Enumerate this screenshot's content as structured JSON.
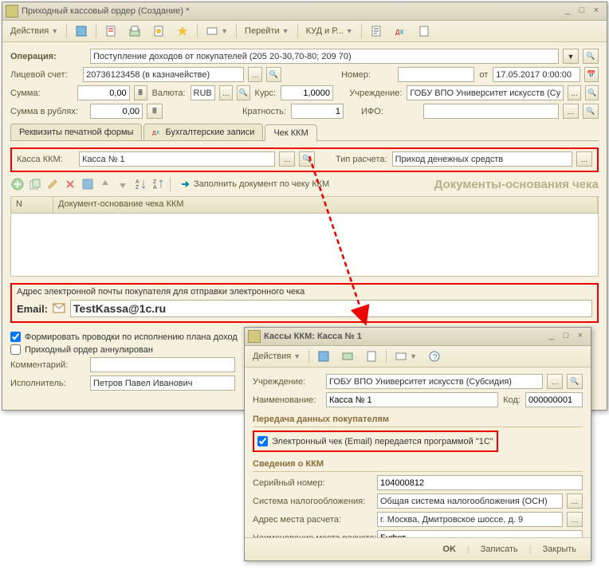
{
  "main": {
    "title": "Приходный кассовый ордер (Создание) *",
    "actions": "Действия",
    "goto": "Перейти",
    "kudir": "КУД и Р...",
    "op_lbl": "Операция:",
    "op_val": "Поступление доходов от покупателей (205 20-30,70-80; 209 70)",
    "acct_lbl": "Лицевой счет:",
    "acct_val": "20736123458 (в казначействе)",
    "num_lbl": "Номер:",
    "num_val": "",
    "ot": "от",
    "date": "17.05.2017 0:00:00",
    "sum_lbl": "Сумма:",
    "sum_val": "0,00",
    "cur_lbl": "Валюта:",
    "cur_val": "RUB",
    "rate_lbl": "Курс:",
    "rate_val": "1,0000",
    "inst_lbl": "Учреждение:",
    "inst_val": "ГОБУ ВПО Университет искусств (Су",
    "sumr_lbl": "Сумма в рублях:",
    "sumr_val": "0,00",
    "mult_lbl": "Кратность:",
    "mult_val": "1",
    "ifo_lbl": "ИФО:",
    "ifo_val": "",
    "tabs": [
      "Реквизиты печатной формы",
      "Бухгалтерские записи",
      "Чек ККМ"
    ],
    "kkm_lbl": "Касса ККМ:",
    "kkm_val": "Касса № 1",
    "calc_lbl": "Тип расчета:",
    "calc_val": "Приход денежных средств",
    "fill": "Заполнить документ по чеку ККМ",
    "dochdr": "Документы-основания чека",
    "col_n": "N",
    "col_doc": "Документ-основание чека ККМ",
    "email_hdr": "Адрес электронной почты покупателя для отправки электронного чека",
    "email_lbl": "Email:",
    "email_val": "TestKassa@1c.ru",
    "chk1": "Формировать проводки по исполнению плана доход",
    "chk2": "Приходный ордер аннулирован",
    "comment_lbl": "Комментарий:",
    "comment_val": "",
    "exec_lbl": "Исполнитель:",
    "exec_val": "Петров Павел Иванович"
  },
  "sub": {
    "title": "Кассы ККМ: Касса № 1",
    "actions": "Действия",
    "inst_lbl": "Учреждение:",
    "inst_val": "ГОБУ ВПО Университет искусств (Субсидия)",
    "name_lbl": "Наименование:",
    "name_val": "Касса № 1",
    "code_lbl": "Код:",
    "code_val": "000000001",
    "sect1": "Передача данных покупателям",
    "echk": "Электронный чек (Email) передается программой \"1С\"",
    "sect2": "Сведения о ККМ",
    "serial_lbl": "Серийный номер:",
    "serial_val": "104000812",
    "tax_lbl": "Система налогообложения:",
    "tax_val": "Общая система налогообложения (ОСН)",
    "addr_lbl": "Адрес места расчета:",
    "addr_val": "г. Москва, Дмитровское шоссе, д. 9",
    "place_lbl": "Наименование места расчета:",
    "place_val": "Буфет",
    "ok": "OK",
    "save": "Записать",
    "close": "Закрыть"
  }
}
